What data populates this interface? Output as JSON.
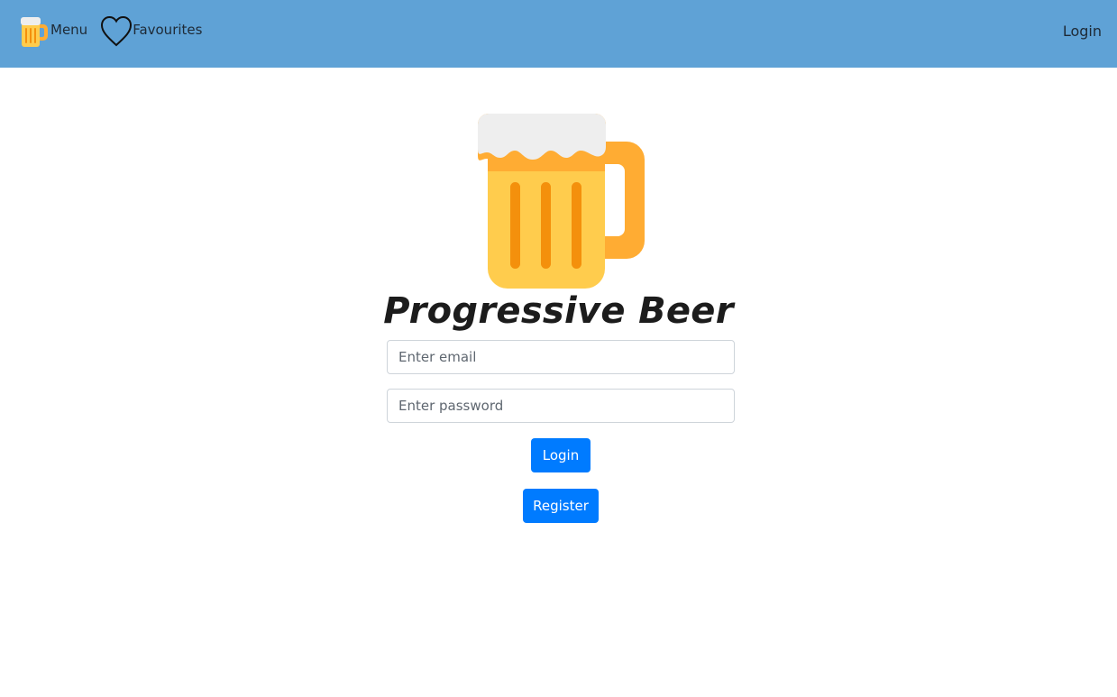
{
  "navbar": {
    "menu_label": "Menu",
    "menu_icon": "beer-mug-icon",
    "favourites_label": "Favourites",
    "favourites_icon": "heart-outline-icon",
    "login_label": "Login",
    "background_color": "#5fa2d6"
  },
  "hero": {
    "icon": "beer-mug-icon",
    "title": "Progressive Beer"
  },
  "form": {
    "email_placeholder": "Enter email",
    "email_value": "",
    "password_placeholder": "Enter password",
    "password_value": "",
    "login_button_label": "Login",
    "register_button_label": "Register",
    "button_color": "#007bff"
  }
}
